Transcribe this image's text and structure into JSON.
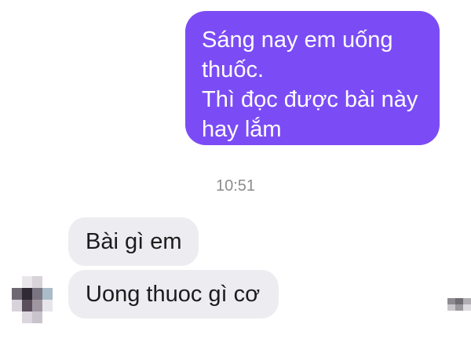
{
  "conversation": {
    "outgoing_message": {
      "lines": [
        "Sáng nay em uống",
        "thuốc.",
        "Thì đọc được bài này",
        "hay lắm"
      ]
    },
    "timestamp": "10:51",
    "incoming_messages": [
      {
        "text": "Bài gì em"
      },
      {
        "text": "Uong thuoc gì cơ"
      }
    ]
  },
  "colors": {
    "outgoing_bubble": "#7b4cf5",
    "incoming_bubble": "#ececf1",
    "timestamp_text": "#8c8c8c"
  },
  "icons": {
    "avatar": "avatar-pixelated",
    "corner": "blurred-icon"
  }
}
